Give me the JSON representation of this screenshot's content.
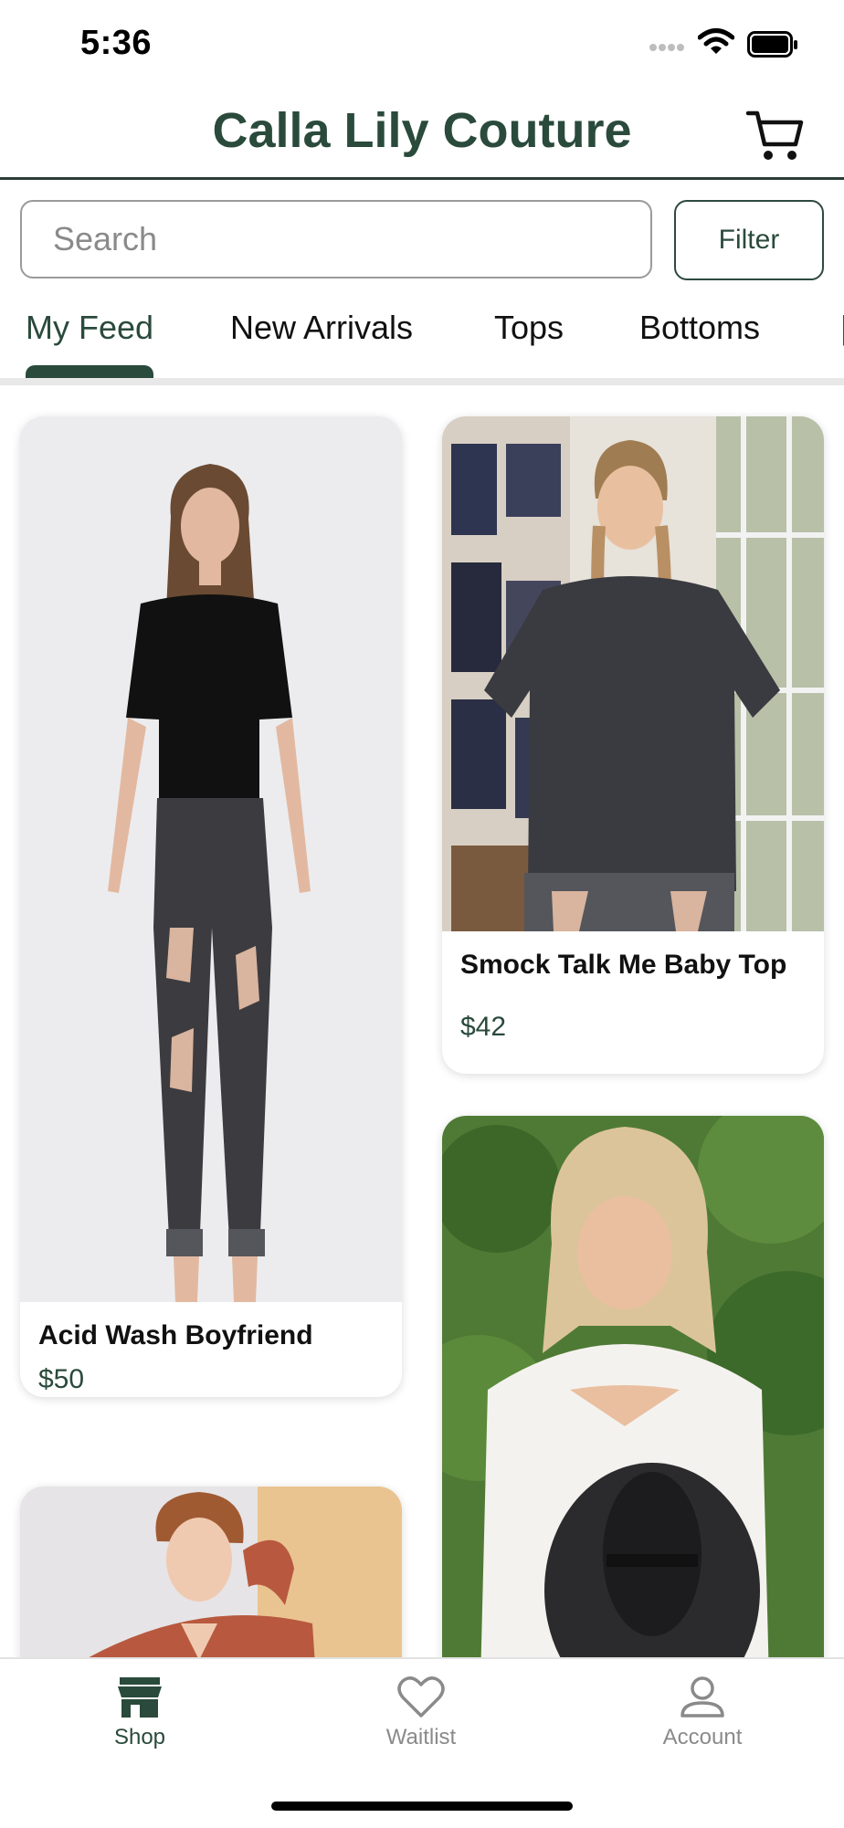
{
  "status_bar": {
    "time": "5:36"
  },
  "header": {
    "title": "Calla Lily Couture",
    "cart_icon": "cart-icon"
  },
  "search": {
    "placeholder": "Search",
    "value": ""
  },
  "filter": {
    "label": "Filter"
  },
  "tabs": [
    {
      "label": "My Feed",
      "active": true
    },
    {
      "label": "New Arrivals"
    },
    {
      "label": "Tops"
    },
    {
      "label": "Bottoms"
    }
  ],
  "products": [
    {
      "name": "Acid Wash Boyfriend",
      "price": "$50"
    },
    {
      "name": "Smock Talk Me Baby Top",
      "price": "$42"
    },
    {
      "name": "",
      "price": ""
    },
    {
      "name": "",
      "price": ""
    }
  ],
  "bottom_nav": [
    {
      "label": "Shop",
      "icon": "storefront-icon",
      "active": true
    },
    {
      "label": "Waitlist",
      "icon": "heart-icon"
    },
    {
      "label": "Account",
      "icon": "person-icon"
    }
  ],
  "colors": {
    "brand": "#2a4a3c",
    "inactive": "#8a8a8a",
    "divider": "#e8e8e8"
  }
}
